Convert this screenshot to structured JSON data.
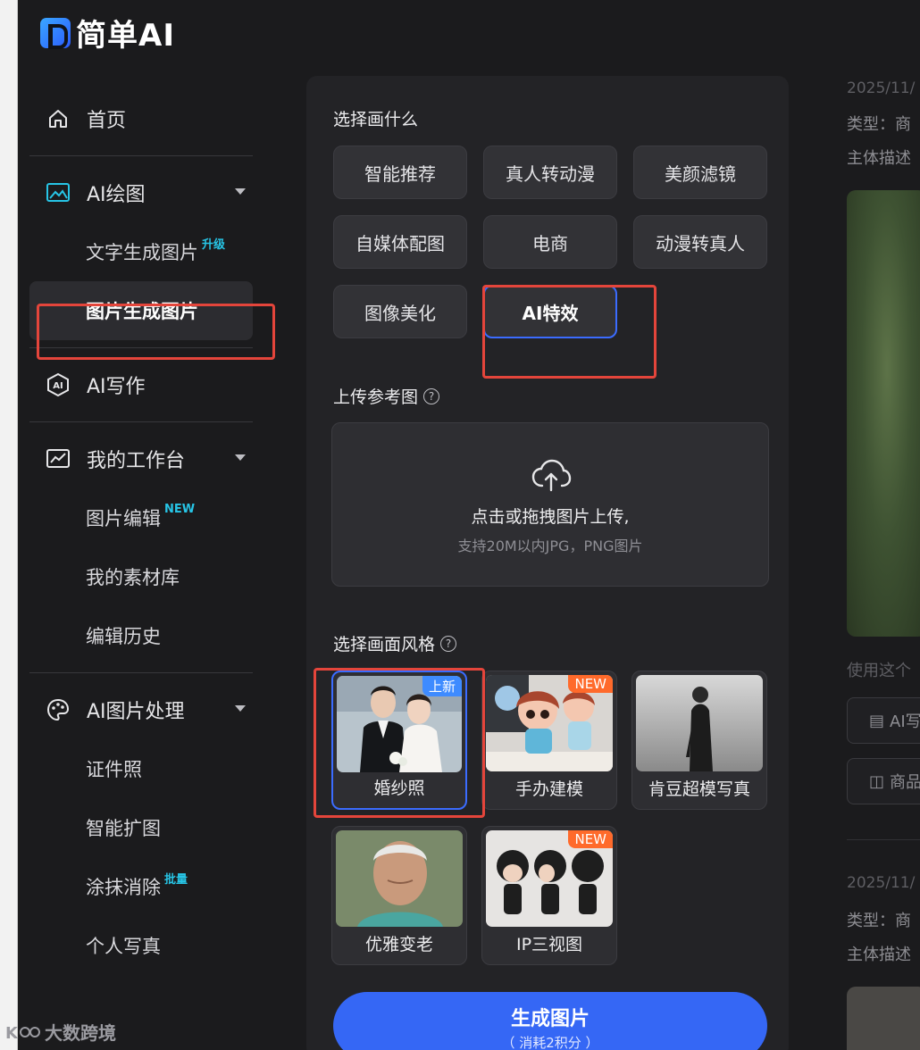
{
  "app": {
    "logo_text": "简单AI"
  },
  "sidebar": {
    "home": "首页",
    "ai_draw": "AI绘图",
    "text_to_image": "文字生成图片",
    "text_to_image_tag": "升级",
    "image_to_image": "图片生成图片",
    "ai_write": "AI写作",
    "workbench": "我的工作台",
    "image_edit": "图片编辑",
    "image_edit_tag": "NEW",
    "material_lib": "我的素材库",
    "edit_history": "编辑历史",
    "ai_image_process": "AI图片处理",
    "id_photo": "证件照",
    "smart_expand": "智能扩图",
    "erase": "涂抹消除",
    "erase_tag": "批量",
    "portrait": "个人写真"
  },
  "panel": {
    "choose_title": "选择画什么",
    "options": [
      "智能推荐",
      "真人转动漫",
      "美颜滤镜",
      "自媒体配图",
      "电商",
      "动漫转真人",
      "图像美化",
      "AI特效"
    ],
    "upload_title": "上传参考图",
    "upload_main": "点击或拖拽图片上传,",
    "upload_hint": "支持20M以内JPG，PNG图片",
    "style_title": "选择画面风格",
    "styles": [
      {
        "label": "婚纱照",
        "badge": "上新"
      },
      {
        "label": "手办建模",
        "badge": "NEW"
      },
      {
        "label": "肯豆超模写真",
        "badge": ""
      },
      {
        "label": "优雅变老",
        "badge": ""
      },
      {
        "label": "IP三视图",
        "badge": "NEW"
      }
    ],
    "generate_label": "生成图片",
    "generate_sub": "（ 消耗2积分 ）"
  },
  "right": {
    "date1": "2025/11/",
    "type1": "类型：商",
    "desc1": "主体描述",
    "use_this": "使用这个",
    "btn1": "AI写",
    "btn2": "商品",
    "date2": "2025/11/",
    "type2": "类型：商",
    "desc2": "主体描述"
  },
  "watermark": {
    "text": "大数跨境"
  },
  "colors": {
    "accent": "#3567f5",
    "annotation": "#e4453b",
    "new_badge": "#ff6a2b"
  }
}
